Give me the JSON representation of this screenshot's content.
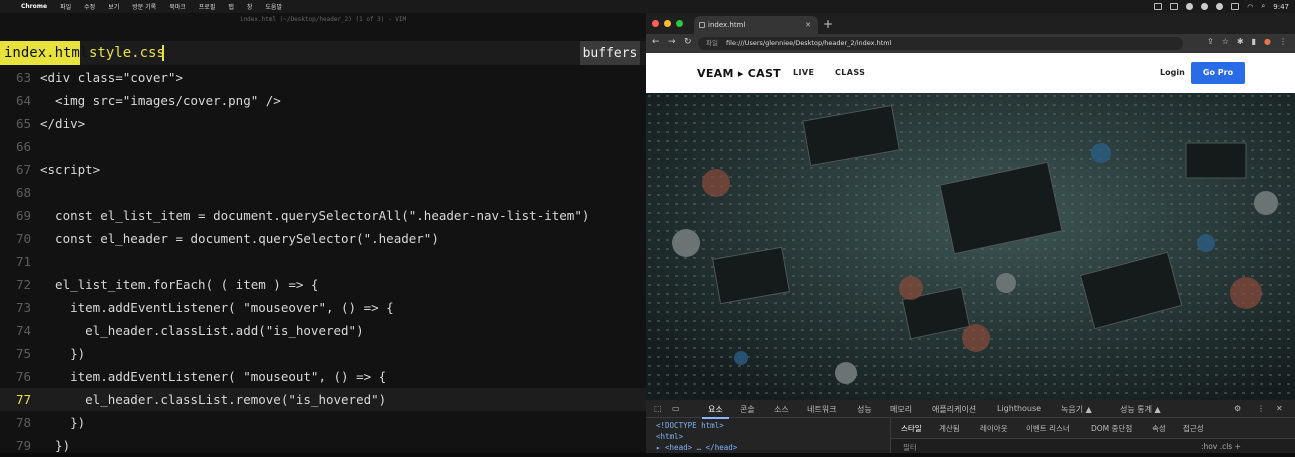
{
  "menubar": {
    "items": [
      "Chrome",
      "파일",
      "수정",
      "보기",
      "방문 기록",
      "북마크",
      "프로필",
      "탭",
      "창",
      "도움말"
    ],
    "clock": "9:47"
  },
  "vim": {
    "window_title": "index.html (~/Desktop/header_2) (1 of 3) - VIM",
    "tabs": {
      "active": "index.html",
      "inactive": "style.css",
      "buffers": "buffers"
    },
    "lines": [
      {
        "n": "63",
        "t": "<div class=\"cover\">"
      },
      {
        "n": "64",
        "t": "  <img src=\"images/cover.png\" />"
      },
      {
        "n": "65",
        "t": "</div>"
      },
      {
        "n": "66",
        "t": ""
      },
      {
        "n": "67",
        "t": "<script>"
      },
      {
        "n": "68",
        "t": ""
      },
      {
        "n": "69",
        "t": "  const el_list_item = document.querySelectorAll(\".header-nav-list-item\")"
      },
      {
        "n": "70",
        "t": "  const el_header = document.querySelector(\".header\")"
      },
      {
        "n": "71",
        "t": ""
      },
      {
        "n": "72",
        "t": "  el_list_item.forEach( ( item ) => {"
      },
      {
        "n": "73",
        "t": "    item.addEventListener( \"mouseover\", () => {"
      },
      {
        "n": "74",
        "t": "      el_header.classList.add(\"is_hovered\")"
      },
      {
        "n": "75",
        "t": "    })"
      },
      {
        "n": "76",
        "t": "    item.addEventListener( \"mouseout\", () => {"
      },
      {
        "n": "77",
        "t": "      el_header.classList.remove(\"is_hovered\")"
      },
      {
        "n": "78",
        "t": "    })"
      },
      {
        "n": "79",
        "t": "  })"
      }
    ],
    "current_line": "77"
  },
  "browser": {
    "tab_title": "index.html",
    "url_prefix": "파일",
    "url": "file:///Users/glenniee/Desktop/header_2/index.html",
    "site": {
      "logo": "VEAM ▸ CAST",
      "nav": [
        "LIVE",
        "CLASS"
      ],
      "login": "Login",
      "cta": "Go Pro"
    },
    "devtools": {
      "tabs": [
        "요소",
        "콘솔",
        "소스",
        "네트워크",
        "성능",
        "메모리",
        "애플리케이션",
        "Lighthouse",
        "녹음기 ▲",
        "성능 통계 ▲"
      ],
      "dom_lines": [
        "<!DOCTYPE html>",
        "<html>",
        "▸ <head> … </head>"
      ],
      "subtabs": [
        "스타일",
        "계산됨",
        "레이아웃",
        "이벤트 리스너",
        "DOM 중단점",
        "속성",
        "접근성"
      ],
      "filter_placeholder": "필터",
      "filter_tools": ":hov .cls +"
    }
  }
}
